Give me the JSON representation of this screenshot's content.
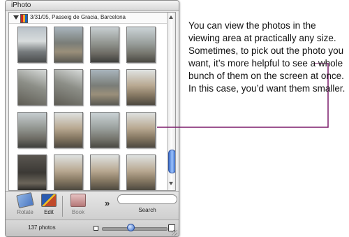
{
  "window": {
    "title": "iPhoto"
  },
  "library": {
    "roll_label": "3/31/05, Passeig de Gracia, Barcelona",
    "photos": [
      {
        "tone": "t0"
      },
      {
        "tone": "t1"
      },
      {
        "tone": "t2"
      },
      {
        "tone": "t3"
      },
      {
        "tone": "t4"
      },
      {
        "tone": "t4"
      },
      {
        "tone": "t1"
      },
      {
        "tone": "t5"
      },
      {
        "tone": "t2"
      },
      {
        "tone": "t5"
      },
      {
        "tone": "t3"
      },
      {
        "tone": "t5"
      },
      {
        "tone": "t6"
      },
      {
        "tone": "t5"
      },
      {
        "tone": "t5"
      },
      {
        "tone": "t5"
      }
    ]
  },
  "toolbar": {
    "rotate_label": "Rotate",
    "edit_label": "Edit",
    "book_label": "Book",
    "more_label": "»",
    "search_value": "",
    "search_label": "Search"
  },
  "status": {
    "photo_count": "137 photos",
    "zoom_fraction": 0.45
  },
  "callout": {
    "text": "You can view the photos in the viewing area at practically any size. Sometimes, to pick out the photo you want, it’s more helpful to see a whole bunch of them on the screen at once. In this case, you’d want them smaller.",
    "color": "#7b1c6b"
  }
}
